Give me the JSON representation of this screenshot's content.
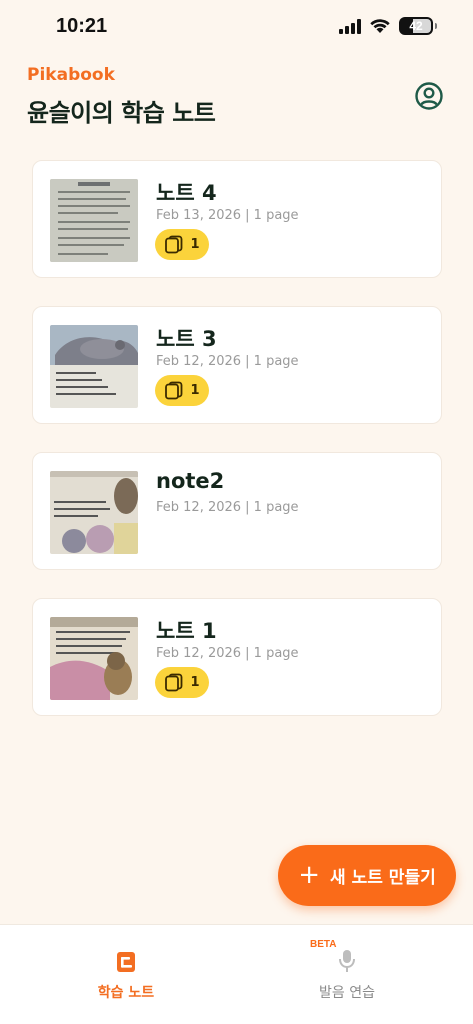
{
  "status_bar": {
    "time": "10:21",
    "battery": "42"
  },
  "header": {
    "brand": "Pikabook",
    "title": "윤슬이의 학습 노트"
  },
  "notes": [
    {
      "title": "노트 4",
      "meta": "Feb 13, 2026 | 1 page",
      "badge_count": "1",
      "has_badge": true
    },
    {
      "title": "노트 3",
      "meta": "Feb 12, 2026 | 1 page",
      "badge_count": "1",
      "has_badge": true
    },
    {
      "title": "note2",
      "meta": "Feb 12, 2026 | 1 page",
      "has_badge": false
    },
    {
      "title": "노트 1",
      "meta": "Feb 12, 2026 | 1 page",
      "badge_count": "1",
      "has_badge": true
    }
  ],
  "fab": {
    "label": "새 노트 만들기",
    "icon": "plus-icon"
  },
  "bottom_nav": [
    {
      "label": "학습 노트",
      "icon": "note-book-icon",
      "active": true
    },
    {
      "label": "발음 연습",
      "icon": "microphone-icon",
      "badge": "BETA",
      "active": false
    }
  ],
  "colors": {
    "accent": "#FA6B19",
    "brand": "#F36E22",
    "badge": "#FBD33B",
    "background": "#FDF6EE",
    "profile_icon": "#1E5A48"
  }
}
